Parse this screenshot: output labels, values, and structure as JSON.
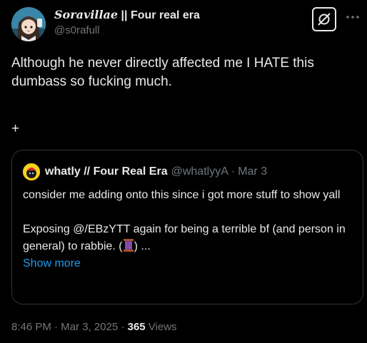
{
  "author": {
    "display_name_stylized": "Soravillae",
    "display_name_rest": " || Four real era",
    "handle": "@s0rafull",
    "avatar_icon": "anime-avatar"
  },
  "actions": {
    "grok_icon": "grok-icon",
    "more_icon": "more-dots-icon"
  },
  "tweet": {
    "text": "Although he never directly affected me I HATE this dumbass so fucking much.",
    "plus": "+"
  },
  "quote": {
    "avatar_icon": "yellow-avatar",
    "name": "whatly // Four Real Era",
    "handle": "@whatlyyA",
    "separator": "·",
    "date": "Mar 3",
    "line1": "consider me adding onto this since i got more stuff to show yall",
    "line2_prefix": "Exposing @/EBzYTT again for being a terrible bf (and person in general) to rabbie. (",
    "emoji_icon": "thread-spool-emoji",
    "line2_suffix": ") ...",
    "show_more": "Show more"
  },
  "meta": {
    "time": "8:46 PM",
    "sep1": " · ",
    "date": "Mar 3, 2025",
    "sep2": " · ",
    "views_count": "365",
    "views_label": " Views"
  },
  "colors": {
    "background": "#000000",
    "text": "#e7e9ea",
    "secondary": "#71767b",
    "link": "#1d9bf0",
    "border": "#2f3336"
  }
}
